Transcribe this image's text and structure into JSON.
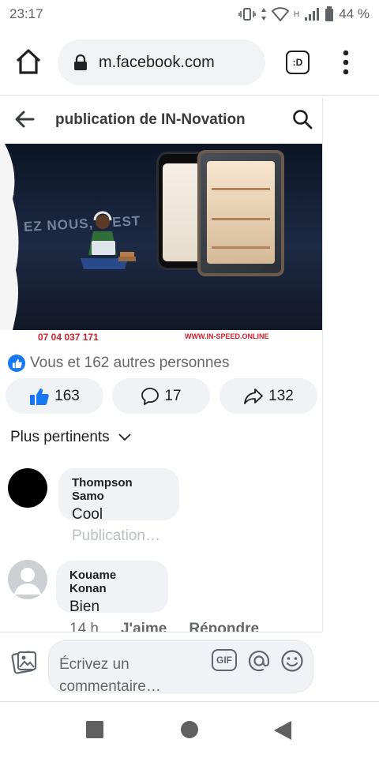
{
  "status_bar": {
    "time": "23:17",
    "network_type": "H",
    "battery_percent": "44 %"
  },
  "browser": {
    "url": "m.facebook.com",
    "tab_label": ":D",
    "icons": [
      "home-icon",
      "lock-icon",
      "tab-switcher-icon",
      "overflow-menu-icon"
    ]
  },
  "header": {
    "title": "publication de IN-Novation"
  },
  "post": {
    "image_text_phone": "07 04 037 171",
    "image_text_url": "WWW.IN-SPEED.ONLINE",
    "image_text_overlay": "EZ NOUS, C'EST",
    "reactions_text": "Vous et 162 autres personnes",
    "like_count": "163",
    "comment_count": "17",
    "share_count": "132"
  },
  "sort": {
    "label": "Plus pertinents"
  },
  "comments": [
    {
      "author": "Thompson Samo",
      "text": "Cool",
      "meta": "Publication…"
    },
    {
      "author": "Kouame Konan",
      "text": "Bien",
      "time": "14 h",
      "like_label": "J'aime",
      "reply_label": "Répondre"
    }
  ],
  "composer": {
    "placeholder": "Écrivez un commentaire…",
    "gif_label": "GIF"
  },
  "colors": {
    "accent": "#1877f2",
    "bubble": "#f0f2f5",
    "secondary_text": "#65676b"
  }
}
